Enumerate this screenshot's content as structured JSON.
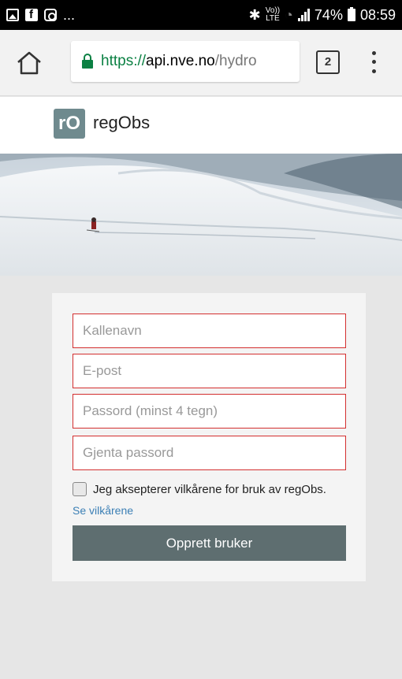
{
  "status_bar": {
    "ellipsis": "...",
    "volte_top": "Vo))",
    "volte_bottom": "LTE",
    "battery": "74%",
    "time": "08:59"
  },
  "browser": {
    "url_scheme": "https://",
    "url_host": "api.nve.no",
    "url_path": "/hydro",
    "tab_count": "2"
  },
  "app": {
    "logo_text": "rO",
    "title": "regObs"
  },
  "form": {
    "nickname_placeholder": "Kallenavn",
    "email_placeholder": "E-post",
    "password_placeholder": "Passord (minst 4 tegn)",
    "repeat_password_placeholder": "Gjenta passord",
    "terms_checkbox_label": "Jeg aksepterer vilkårene for bruk av regObs.",
    "terms_link": "Se vilkårene",
    "submit_label": "Opprett bruker"
  },
  "colors": {
    "field_border": "#d32f2f",
    "button_bg": "#5e6e70",
    "link": "#3b7fb5",
    "secure_green": "#0b8043"
  }
}
